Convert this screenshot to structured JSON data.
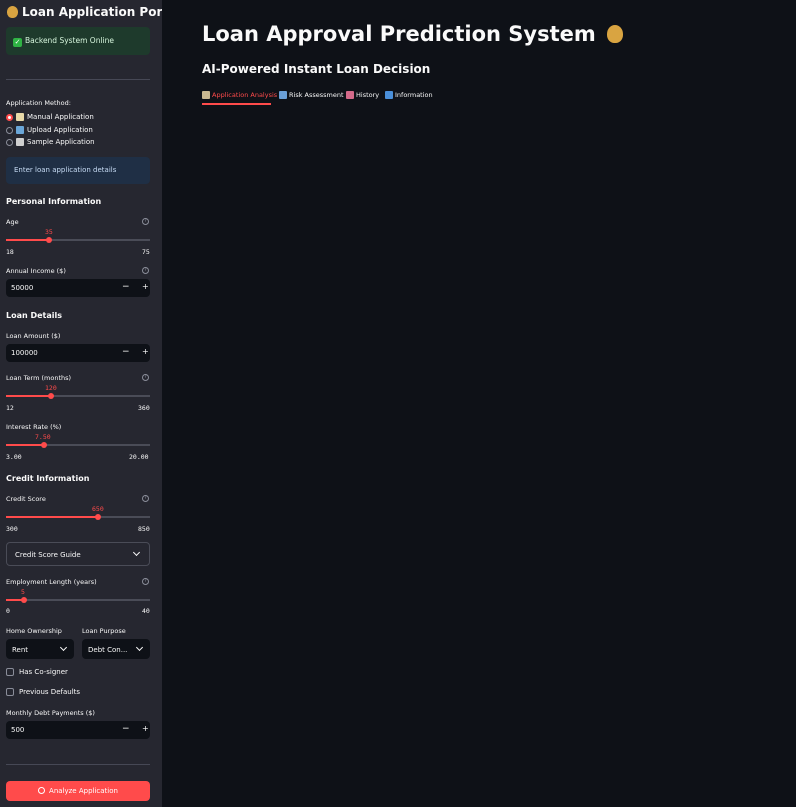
{
  "sidebar": {
    "title": "Loan Application Portal",
    "title_icon": "money-bag-icon",
    "status": "Backend System Online",
    "method_label": "Application Method:",
    "methods": [
      {
        "label": "Manual Application",
        "icon": "memo-icon",
        "selected": true
      },
      {
        "label": "Upload Application",
        "icon": "folder-icon",
        "selected": false
      },
      {
        "label": "Sample Application",
        "icon": "dice-icon",
        "selected": false
      }
    ],
    "info": "Enter loan application details",
    "personal": {
      "heading": "Personal Information",
      "age": {
        "label": "Age",
        "value": "35",
        "min": "18",
        "max": "75"
      },
      "income": {
        "label": "Annual Income ($)",
        "value": "50000"
      }
    },
    "loan": {
      "heading": "Loan Details",
      "amount": {
        "label": "Loan Amount ($)",
        "value": "100000"
      },
      "term": {
        "label": "Loan Term (months)",
        "value": "120",
        "min": "12",
        "max": "360"
      },
      "rate": {
        "label": "Interest Rate (%)",
        "value": "7.50",
        "min": "3.00",
        "max": "20.00"
      }
    },
    "credit": {
      "heading": "Credit Information",
      "score": {
        "label": "Credit Score",
        "value": "650",
        "min": "300",
        "max": "850"
      },
      "guide": "Credit Score Guide",
      "employment": {
        "label": "Employment Length (years)",
        "value": "5",
        "min": "0",
        "max": "40"
      },
      "home_label": "Home Ownership",
      "home_value": "Rent",
      "purpose_label": "Loan Purpose",
      "purpose_value": "Debt Con...",
      "cosigner": "Has Co-signer",
      "defaults": "Previous Defaults",
      "debt": {
        "label": "Monthly Debt Payments ($)",
        "value": "500"
      }
    },
    "analyze": "Analyze Application"
  },
  "main": {
    "title": "Loan Approval Prediction System",
    "title_icon": "money-bag-icon",
    "subtitle": "AI-Powered Instant Loan Decision",
    "tabs": [
      {
        "label": "Application Analysis",
        "icon": "clipboard-icon",
        "active": true
      },
      {
        "label": "Risk Assessment",
        "icon": "bar-chart-icon",
        "active": false
      },
      {
        "label": "History",
        "icon": "line-chart-icon",
        "active": false
      },
      {
        "label": "Information",
        "icon": "info-icon",
        "active": false
      }
    ]
  },
  "colors": {
    "accent": "#ff4b4b",
    "sidebar_bg": "#262730",
    "main_bg": "#0e1117"
  }
}
